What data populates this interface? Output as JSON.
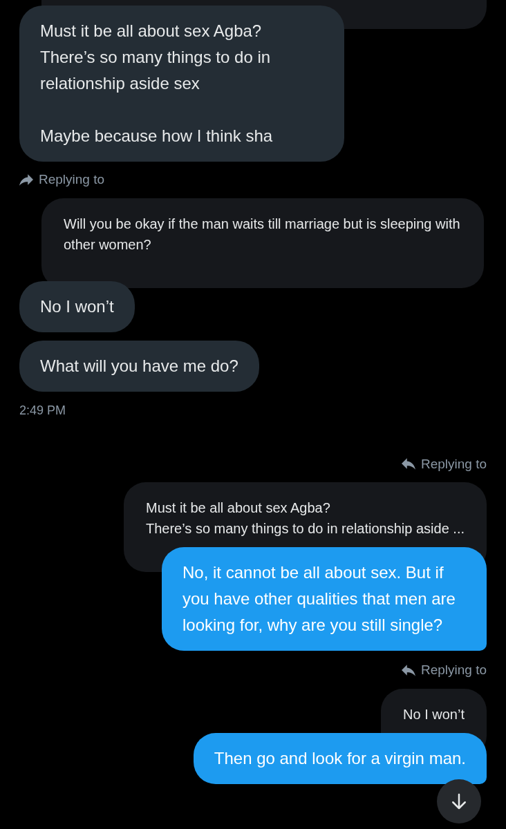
{
  "thread": [
    {
      "kind": "quote_stub",
      "outgoing": false
    },
    {
      "kind": "message",
      "outgoing": false,
      "text": "Must it be all about sex Agba?\nThere’s so many things to do in relationship aside sex\n\nMaybe because how I think sha"
    },
    {
      "kind": "replying",
      "outgoing": false,
      "label": "Replying to"
    },
    {
      "kind": "quote",
      "outgoing": false,
      "text": "Will you be okay if the man waits till marriage but is sleeping with other women?"
    },
    {
      "kind": "message",
      "outgoing": false,
      "text": "No I won’t"
    },
    {
      "kind": "message",
      "outgoing": false,
      "text": "What will you have me do?"
    },
    {
      "kind": "time",
      "text": "2:49 PM"
    },
    {
      "kind": "replying",
      "outgoing": true,
      "label": "Replying to"
    },
    {
      "kind": "quote",
      "outgoing": true,
      "text": "Must it be all about sex Agba?\nThere’s so many things to do in relationship aside ..."
    },
    {
      "kind": "message",
      "outgoing": true,
      "text": "No, it cannot be all about sex. But if you have other qualities that men are looking for, why are you still single?"
    },
    {
      "kind": "replying",
      "outgoing": true,
      "label": "Replying to"
    },
    {
      "kind": "quote",
      "outgoing": true,
      "text": "No I won’t"
    },
    {
      "kind": "message",
      "outgoing": true,
      "text": "Then go and look for a virgin man."
    }
  ]
}
